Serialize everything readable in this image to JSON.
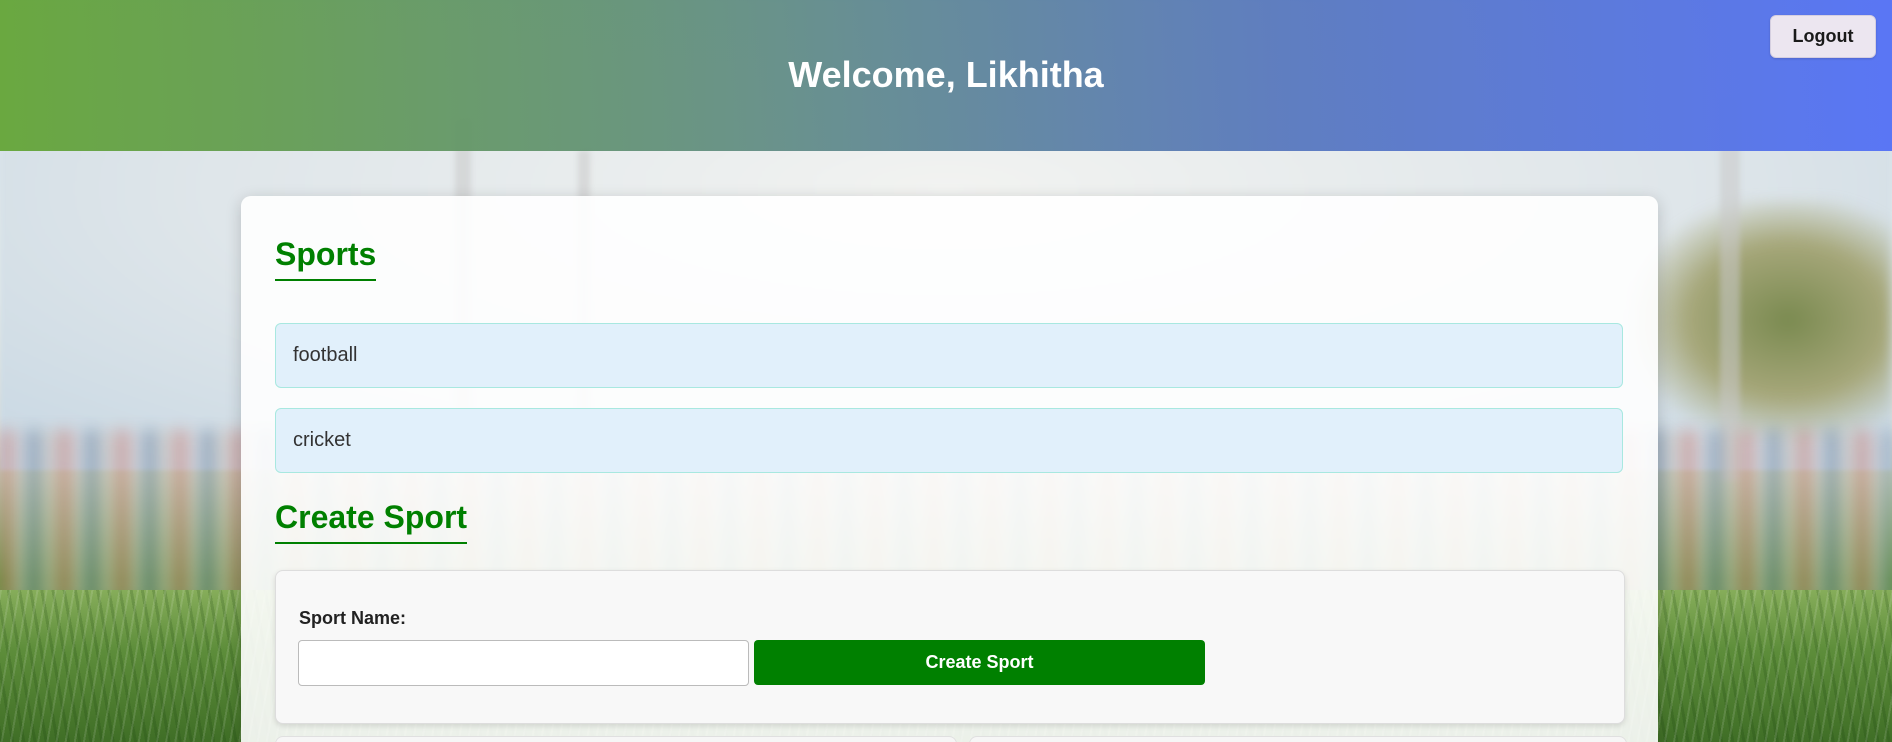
{
  "header": {
    "title": "Welcome, Likhitha",
    "logout_label": "Logout"
  },
  "sports_section": {
    "heading": "Sports",
    "items": [
      {
        "label": "football"
      },
      {
        "label": "cricket"
      }
    ]
  },
  "create_section": {
    "heading": "Create Sport",
    "field_label": "Sport Name:",
    "field_value": "",
    "field_placeholder": "",
    "submit_label": "Create Sport"
  },
  "colors": {
    "accent_green": "#008000",
    "header_gradient_start": "#64a537",
    "header_gradient_end": "#5673f5",
    "item_background": "#e1f0fb"
  }
}
